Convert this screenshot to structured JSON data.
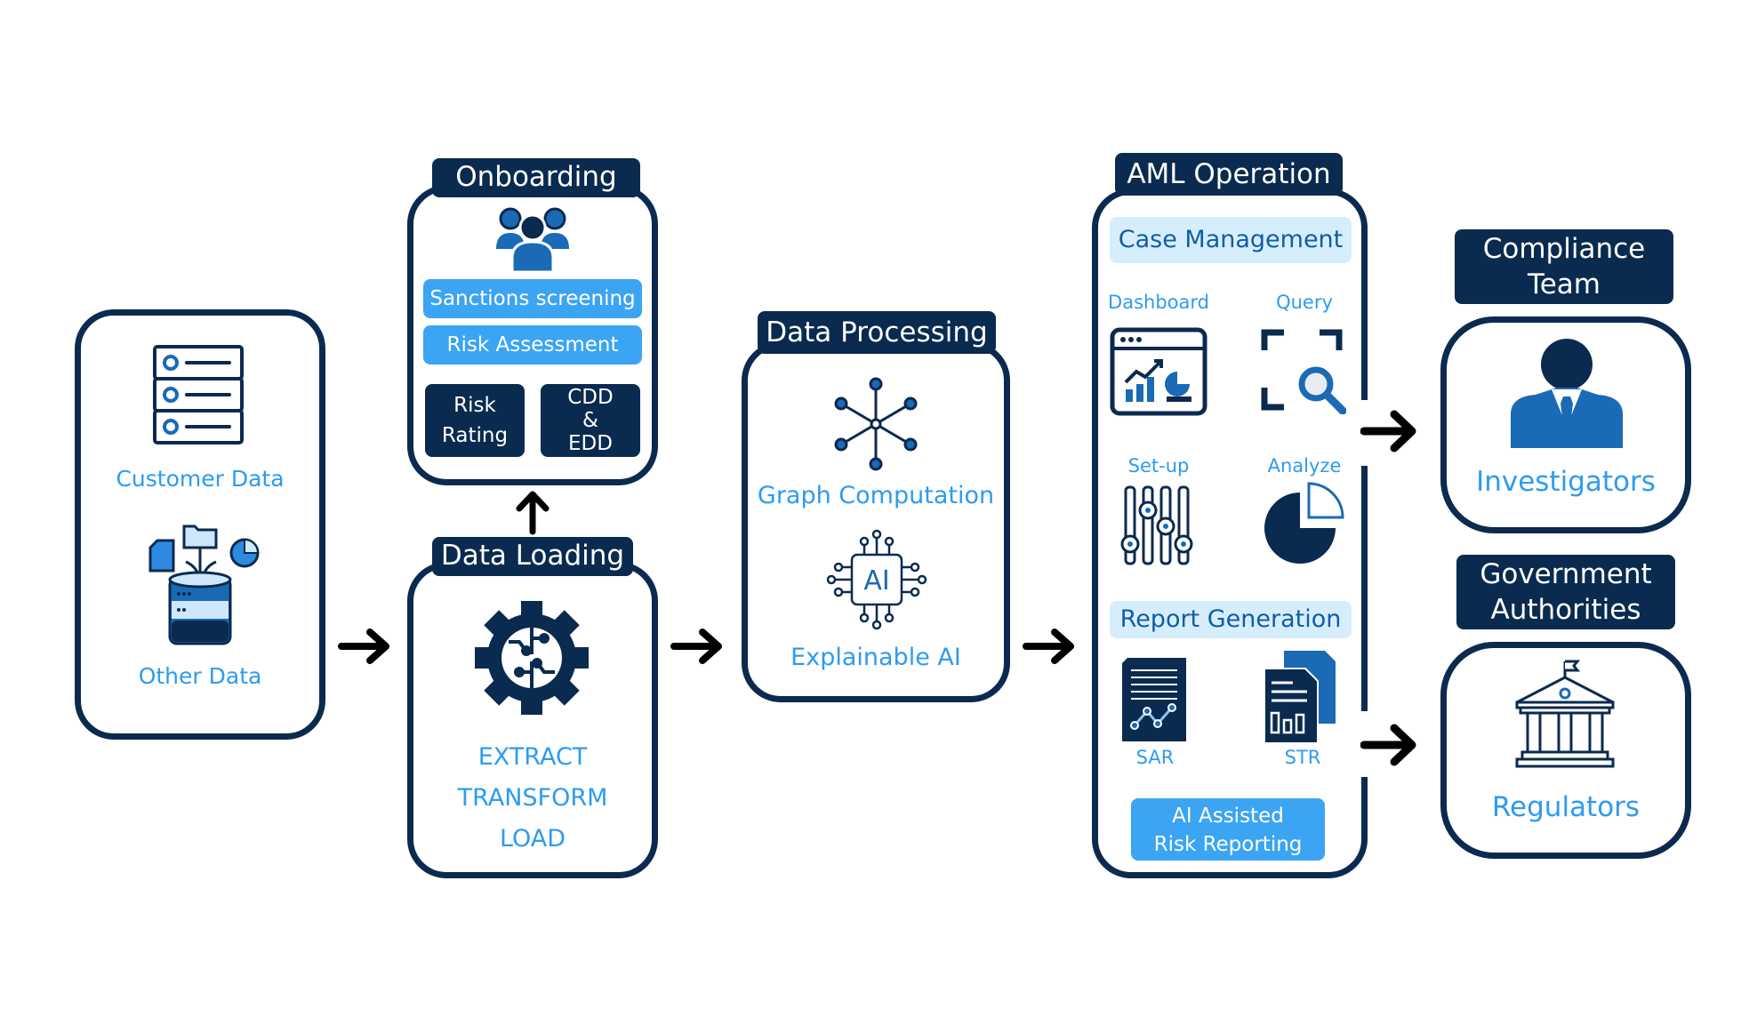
{
  "colors": {
    "navy": "#0b2a4f",
    "accent": "#2d9bf0",
    "pill": "#3ba4f3",
    "light": "#d6eefc",
    "mid_blue": "#1a6ab5"
  },
  "sources": {
    "customer_data": "Customer Data",
    "other_data": "Other Data"
  },
  "onboarding": {
    "title": "Onboarding",
    "sanctions": "Sanctions screening",
    "risk_assessment": "Risk Assessment",
    "risk_rating": [
      "Risk",
      "Rating"
    ],
    "cdd_edd": [
      "CDD",
      "&",
      "EDD"
    ]
  },
  "data_loading": {
    "title": "Data Loading",
    "steps": [
      "EXTRACT",
      "TRANSFORM",
      "LOAD"
    ]
  },
  "data_processing": {
    "title": "Data Processing",
    "graph": "Graph Computation",
    "xai": "Explainable AI",
    "ai_chip_text": "AI"
  },
  "aml_operation": {
    "title": "AML Operation",
    "case_management": "Case Management",
    "dashboard": "Dashboard",
    "query": "Query",
    "setup": "Set-up",
    "analyze": "Analyze",
    "report_generation": "Report Generation",
    "sar": "SAR",
    "str": "STR",
    "ai_reporting": [
      "AI Assisted",
      "Risk Reporting"
    ]
  },
  "compliance": {
    "title": [
      "Compliance",
      "Team"
    ],
    "label": "Investigators"
  },
  "government": {
    "title": [
      "Government",
      "Authorities"
    ],
    "label": "Regulators"
  }
}
